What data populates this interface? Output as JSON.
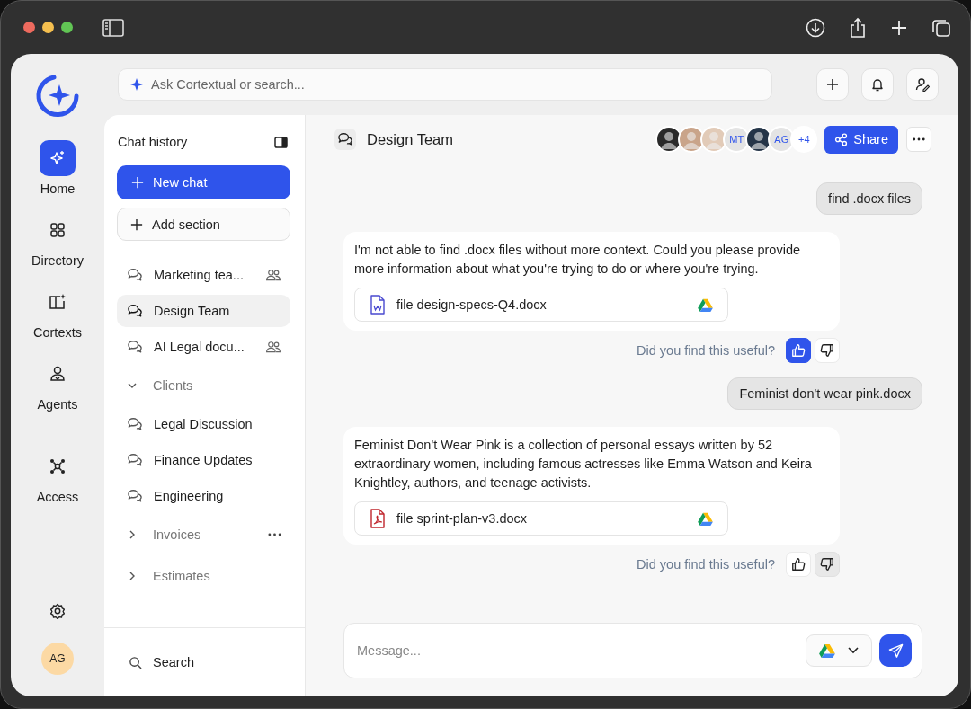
{
  "nav": {
    "items": [
      {
        "label": "Home",
        "selected": true
      },
      {
        "label": "Directory",
        "selected": false
      },
      {
        "label": "Cortexts",
        "selected": false
      },
      {
        "label": "Agents",
        "selected": false
      }
    ],
    "lower_items": [
      {
        "label": "Access",
        "selected": false
      }
    ],
    "avatar": "AG"
  },
  "search": {
    "placeholder": "Ask Cortextual or search..."
  },
  "chat_history": {
    "title": "Chat history",
    "new_chat": "New chat",
    "add_section": "Add section",
    "entries": [
      {
        "kind": "chat",
        "label": "Marketing tea...",
        "shared": true,
        "selected": false
      },
      {
        "kind": "chat",
        "label": "Design Team",
        "shared": false,
        "selected": true
      },
      {
        "kind": "chat",
        "label": "AI Legal docu...",
        "shared": true,
        "selected": false
      },
      {
        "kind": "section",
        "label": "Clients",
        "expanded": true,
        "menu": false,
        "children": [
          {
            "kind": "chat",
            "label": "Legal Discussion",
            "shared": false,
            "selected": false
          },
          {
            "kind": "chat",
            "label": "Finance Updates",
            "shared": false,
            "selected": false
          },
          {
            "kind": "chat",
            "label": "Engineering",
            "shared": false,
            "selected": false
          }
        ]
      },
      {
        "kind": "section",
        "label": "Invoices",
        "expanded": false,
        "menu": true
      },
      {
        "kind": "section",
        "label": "Estimates",
        "expanded": false,
        "menu": false
      }
    ],
    "search": "Search"
  },
  "conversation": {
    "title": "Design Team",
    "participants": [
      {
        "kind": "photo",
        "color": "#2a2a2a"
      },
      {
        "kind": "photo",
        "color": "#c9a48a"
      },
      {
        "kind": "photo",
        "color": "#e2cbb8"
      },
      {
        "kind": "initials",
        "text": "MT"
      },
      {
        "kind": "photo",
        "color": "#253548"
      },
      {
        "kind": "initials",
        "text": "AG"
      },
      {
        "kind": "count",
        "text": "+4"
      }
    ],
    "share": "Share",
    "messages": [
      {
        "kind": "user",
        "text": "find .docx files"
      },
      {
        "kind": "assistant",
        "text": "I'm not able to find .docx files without more context. Could you please provide more information about what you're trying to do or where you're trying.",
        "file": {
          "name": "file design-specs-Q4.docx",
          "kind": "word"
        },
        "feedback": {
          "prompt": "Did you find this useful?",
          "buttons": [
            {
              "kind": "up",
              "selected": true
            },
            {
              "kind": "down",
              "selected": false
            }
          ]
        }
      },
      {
        "kind": "user",
        "text": "Feminist don't wear pink.docx"
      },
      {
        "kind": "assistant",
        "text": "Feminist Don't Wear Pink is a collection of personal essays written by 52 extraordinary women, including famous actresses like Emma Watson and Keira Knightley, authors, and teenage activists.",
        "file": {
          "name": "file sprint-plan-v3.docx",
          "kind": "pdf"
        },
        "feedback": {
          "prompt": "Did you find this useful?",
          "buttons": [
            {
              "kind": "up",
              "selected": false
            },
            {
              "kind": "down",
              "selected": true
            }
          ]
        }
      }
    ],
    "composer": {
      "placeholder": "Message..."
    }
  }
}
